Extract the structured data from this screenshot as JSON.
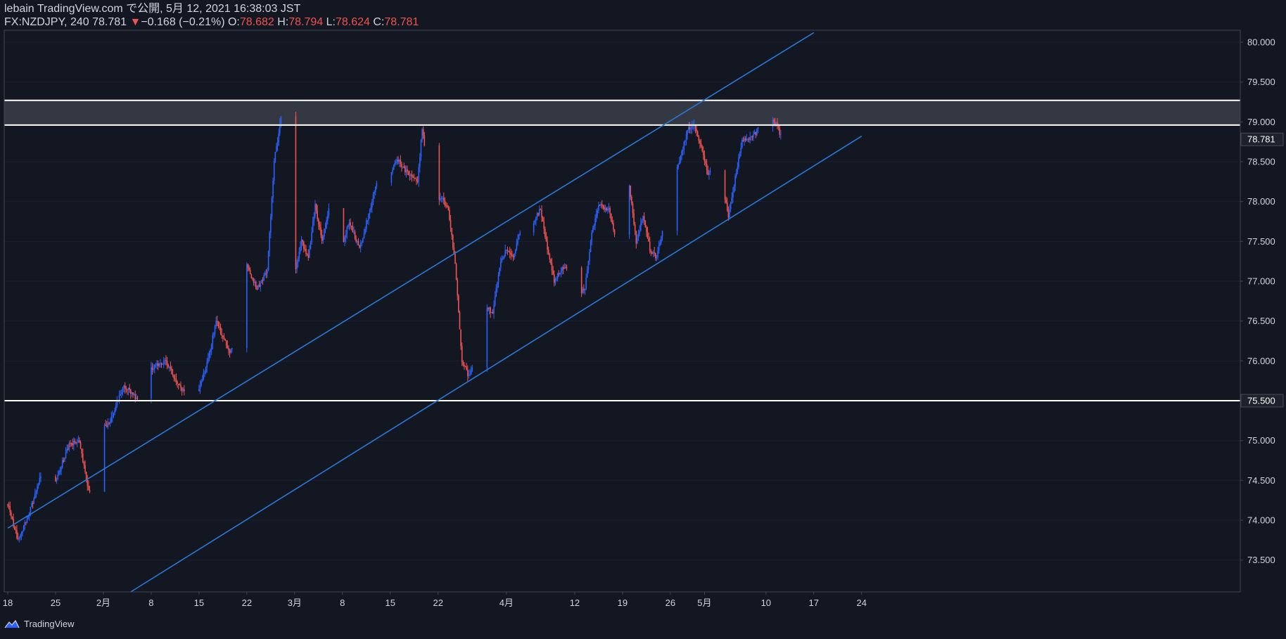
{
  "header": {
    "publisher": "lebain TradingView.com で公開, 5月 12, 2021 16:38:03 JST",
    "symbol": "FX:NZDJPY, 240",
    "last": "78.781",
    "change_arrow": "▼",
    "change": "−0.168 (−0.21%)",
    "o_label": "O:",
    "o_value": "78.682",
    "h_label": "H:",
    "h_value": "78.794",
    "l_label": "L:",
    "l_value": "78.624",
    "c_label": "C:",
    "c_value": "78.781"
  },
  "footer": {
    "brand": "TradingView",
    "logo_icon": "tradingview-logo-icon"
  },
  "colors": {
    "background": "#131722",
    "up": "#2962ff",
    "down": "#ef5350",
    "channel": "#2979d9",
    "level": "#ffffff",
    "zone": "#363a45"
  },
  "chart_data": {
    "type": "candlestick",
    "symbol": "FX:NZDJPY",
    "interval": "240",
    "ylim": [
      73.1,
      80.15
    ],
    "y_ticks": [
      "73.500",
      "74.000",
      "74.500",
      "75.000",
      "75.500",
      "76.000",
      "76.500",
      "77.000",
      "77.500",
      "78.000",
      "78.500",
      "79.000",
      "79.500",
      "80.000"
    ],
    "x_tick_labels": [
      {
        "label": "18",
        "day": 0
      },
      {
        "label": "25",
        "day": 7
      },
      {
        "label": "2月",
        "day": 14
      },
      {
        "label": "8",
        "day": 21
      },
      {
        "label": "15",
        "day": 28
      },
      {
        "label": "22",
        "day": 35
      },
      {
        "label": "3月",
        "day": 42
      },
      {
        "label": "8",
        "day": 49
      },
      {
        "label": "15",
        "day": 56
      },
      {
        "label": "22",
        "day": 63
      },
      {
        "label": "4月",
        "day": 73
      },
      {
        "label": "12",
        "day": 83
      },
      {
        "label": "19",
        "day": 90
      },
      {
        "label": "26",
        "day": 97
      },
      {
        "label": "5月",
        "day": 102
      },
      {
        "label": "10",
        "day": 111
      },
      {
        "label": "17",
        "day": 118
      },
      {
        "label": "24",
        "day": 125
      }
    ],
    "price_labels": [
      {
        "value": "78.781",
        "price": 78.781
      },
      {
        "value": "75.500",
        "price": 75.5
      }
    ],
    "horizontal_levels": [
      75.5,
      78.96,
      79.27
    ],
    "resistance_zone": [
      78.96,
      79.27
    ],
    "channel_lines": [
      {
        "name": "upper channel",
        "points": [
          {
            "day": 0,
            "price": 73.9
          },
          {
            "day": 118,
            "price": 80.12
          }
        ]
      },
      {
        "name": "lower channel",
        "points": [
          {
            "day": 18,
            "price": 73.1
          },
          {
            "day": 125,
            "price": 78.82
          }
        ]
      }
    ],
    "price_path": [
      {
        "day": 0,
        "price": 74.2
      },
      {
        "day": 1.5,
        "price": 73.75
      },
      {
        "day": 3,
        "price": 74.05
      },
      {
        "day": 5,
        "price": 74.6
      },
      {
        "day": 7,
        "price": 74.5
      },
      {
        "day": 9,
        "price": 74.95
      },
      {
        "day": 10.5,
        "price": 75.0
      },
      {
        "day": 11.5,
        "price": 74.5
      },
      {
        "day": 12.3,
        "price": 74.25
      },
      {
        "day": 13.5,
        "price": 75.1
      },
      {
        "day": 15,
        "price": 75.25
      },
      {
        "day": 17,
        "price": 75.7
      },
      {
        "day": 19,
        "price": 75.5
      },
      {
        "day": 21,
        "price": 75.9
      },
      {
        "day": 23,
        "price": 76.0
      },
      {
        "day": 25,
        "price": 75.7
      },
      {
        "day": 27,
        "price": 75.45
      },
      {
        "day": 29,
        "price": 75.9
      },
      {
        "day": 30.5,
        "price": 76.5
      },
      {
        "day": 32.5,
        "price": 76.1
      },
      {
        "day": 34,
        "price": 76.5
      },
      {
        "day": 35,
        "price": 77.2
      },
      {
        "day": 36.5,
        "price": 76.9
      },
      {
        "day": 38,
        "price": 77.15
      },
      {
        "day": 39,
        "price": 78.5
      },
      {
        "day": 40,
        "price": 79.05
      },
      {
        "day": 41,
        "price": 78.0
      },
      {
        "day": 42,
        "price": 77.1
      },
      {
        "day": 43,
        "price": 77.5
      },
      {
        "day": 44,
        "price": 77.3
      },
      {
        "day": 45,
        "price": 77.95
      },
      {
        "day": 46,
        "price": 77.5
      },
      {
        "day": 47,
        "price": 77.9
      },
      {
        "day": 48.5,
        "price": 77.3
      },
      {
        "day": 50,
        "price": 77.75
      },
      {
        "day": 51.5,
        "price": 77.4
      },
      {
        "day": 53,
        "price": 77.9
      },
      {
        "day": 54.5,
        "price": 78.4
      },
      {
        "day": 56,
        "price": 78.3
      },
      {
        "day": 57,
        "price": 78.55
      },
      {
        "day": 58.5,
        "price": 78.35
      },
      {
        "day": 60,
        "price": 78.25
      },
      {
        "day": 60.7,
        "price": 78.95
      },
      {
        "day": 61.5,
        "price": 78.3
      },
      {
        "day": 62.5,
        "price": 78.0
      },
      {
        "day": 63.5,
        "price": 78.05
      },
      {
        "day": 64.5,
        "price": 77.9
      },
      {
        "day": 65.5,
        "price": 77.2
      },
      {
        "day": 66.5,
        "price": 76.0
      },
      {
        "day": 67.5,
        "price": 75.8
      },
      {
        "day": 68.5,
        "price": 76.0
      },
      {
        "day": 70,
        "price": 76.7
      },
      {
        "day": 71,
        "price": 76.6
      },
      {
        "day": 72,
        "price": 77.2
      },
      {
        "day": 73,
        "price": 77.4
      },
      {
        "day": 74,
        "price": 77.3
      },
      {
        "day": 75.5,
        "price": 77.8
      },
      {
        "day": 77,
        "price": 77.75
      },
      {
        "day": 78,
        "price": 77.9
      },
      {
        "day": 79,
        "price": 77.4
      },
      {
        "day": 80,
        "price": 77.0
      },
      {
        "day": 81,
        "price": 77.15
      },
      {
        "day": 82,
        "price": 77.2
      },
      {
        "day": 83,
        "price": 76.85
      },
      {
        "day": 84.5,
        "price": 76.9
      },
      {
        "day": 85.5,
        "price": 77.6
      },
      {
        "day": 86.5,
        "price": 77.95
      },
      {
        "day": 88,
        "price": 77.9
      },
      {
        "day": 89,
        "price": 77.5
      },
      {
        "day": 90,
        "price": 77.7
      },
      {
        "day": 91,
        "price": 78.2
      },
      {
        "day": 92,
        "price": 77.5
      },
      {
        "day": 93,
        "price": 77.8
      },
      {
        "day": 94,
        "price": 77.4
      },
      {
        "day": 95,
        "price": 77.3
      },
      {
        "day": 96.5,
        "price": 77.9
      },
      {
        "day": 97.5,
        "price": 78.3
      },
      {
        "day": 98.5,
        "price": 78.55
      },
      {
        "day": 99.5,
        "price": 78.9
      },
      {
        "day": 100.5,
        "price": 78.95
      },
      {
        "day": 101.5,
        "price": 78.7
      },
      {
        "day": 102.5,
        "price": 78.35
      },
      {
        "day": 103.5,
        "price": 78.5
      },
      {
        "day": 104.5,
        "price": 78.3
      },
      {
        "day": 105.5,
        "price": 77.8
      },
      {
        "day": 106.5,
        "price": 78.3
      },
      {
        "day": 107.5,
        "price": 78.75
      },
      {
        "day": 108.5,
        "price": 78.8
      },
      {
        "day": 109.5,
        "price": 78.85
      },
      {
        "day": 110.5,
        "price": 79.1
      },
      {
        "day": 111.3,
        "price": 79.32
      },
      {
        "day": 112,
        "price": 79.0
      },
      {
        "day": 112.7,
        "price": 78.95
      },
      {
        "day": 113.3,
        "price": 78.78
      }
    ]
  }
}
